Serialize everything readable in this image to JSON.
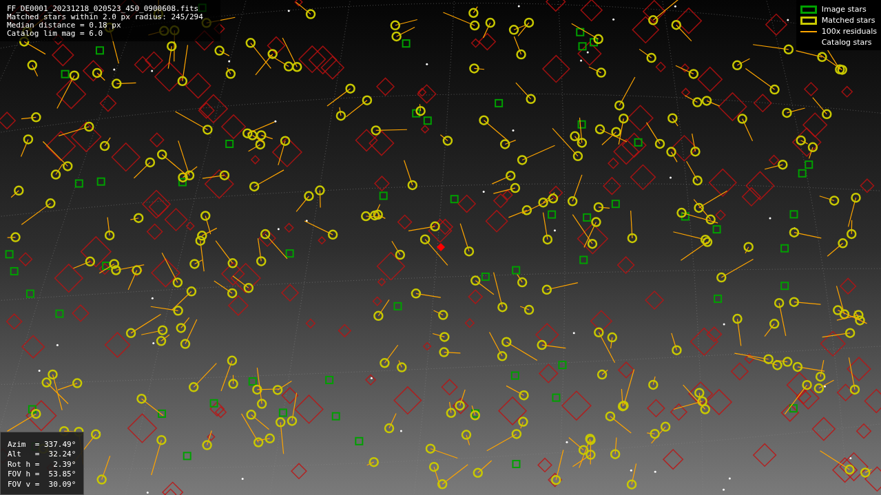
{
  "info": {
    "lines": [
      "FF_DE0001_20231218_020523_450_0900608.fits",
      "Matched stars within 2.0 px radius: 245/294",
      "Median distance = 0.18 px",
      "Catalog lim mag = 6.0"
    ]
  },
  "legend": [
    {
      "kind": "box",
      "label": "Image stars",
      "color": "#00a000"
    },
    {
      "kind": "box",
      "label": "Matched stars",
      "color": "#c8c800"
    },
    {
      "kind": "line",
      "label": "100x residuals",
      "color": "#ffa500"
    },
    {
      "kind": "none",
      "label": "Catalog stars"
    }
  ],
  "pointing": {
    "lines": [
      "Azim  = 337.49°",
      "Alt   =  32.24°",
      "Rot h =   2.39°",
      "FOV h =  53.85°",
      "FOV v =  30.09°"
    ]
  }
}
